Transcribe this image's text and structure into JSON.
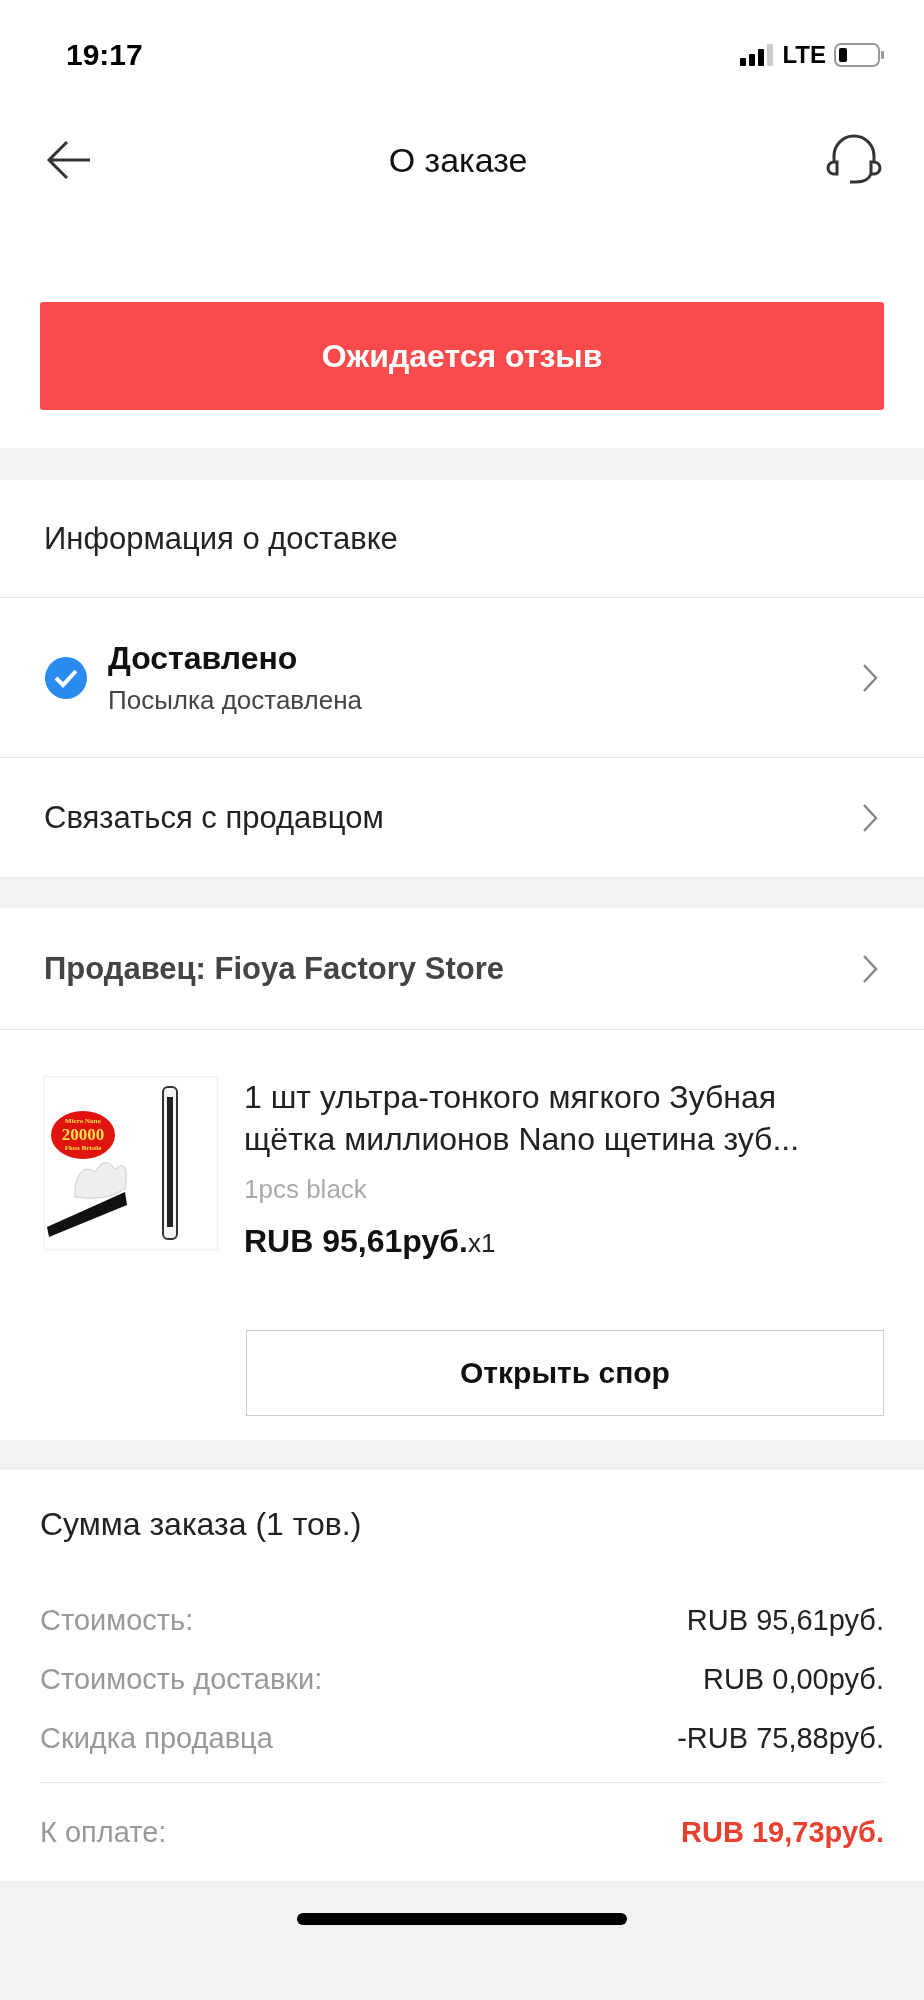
{
  "status_bar": {
    "time": "19:17",
    "network": "LTE"
  },
  "header": {
    "title": "О заказе"
  },
  "review_button": "Ожидается отзыв",
  "delivery": {
    "heading": "Информация о доставке",
    "status": "Доставлено",
    "detail": "Посылка доставлена",
    "contact": "Связаться с продавцом"
  },
  "seller": "Продавец: Fioya Factory Store",
  "product": {
    "name_lines": [
      "1 шт ультра-тонкого мягкого Зубная",
      "щётка миллионов Nano щетина зуб..."
    ],
    "variant": "1pcs black",
    "price": "RUB 95,61руб.",
    "quantity": "x1",
    "image_badge": [
      "Micro Nano",
      "20000",
      "Floss Bristle"
    ]
  },
  "dispute_button": "Открыть спор",
  "summary": {
    "title": "Сумма заказа (1 тов.)",
    "rows": [
      {
        "label": "Стоимость:",
        "value": "RUB 95,61руб."
      },
      {
        "label": "Стоимость доставки:",
        "value": "RUB 0,00руб."
      },
      {
        "label": "Скидка продавца",
        "value": "-RUB 75,88руб."
      }
    ],
    "total": {
      "label": "К оплате:",
      "value": "RUB 19,73руб."
    }
  }
}
